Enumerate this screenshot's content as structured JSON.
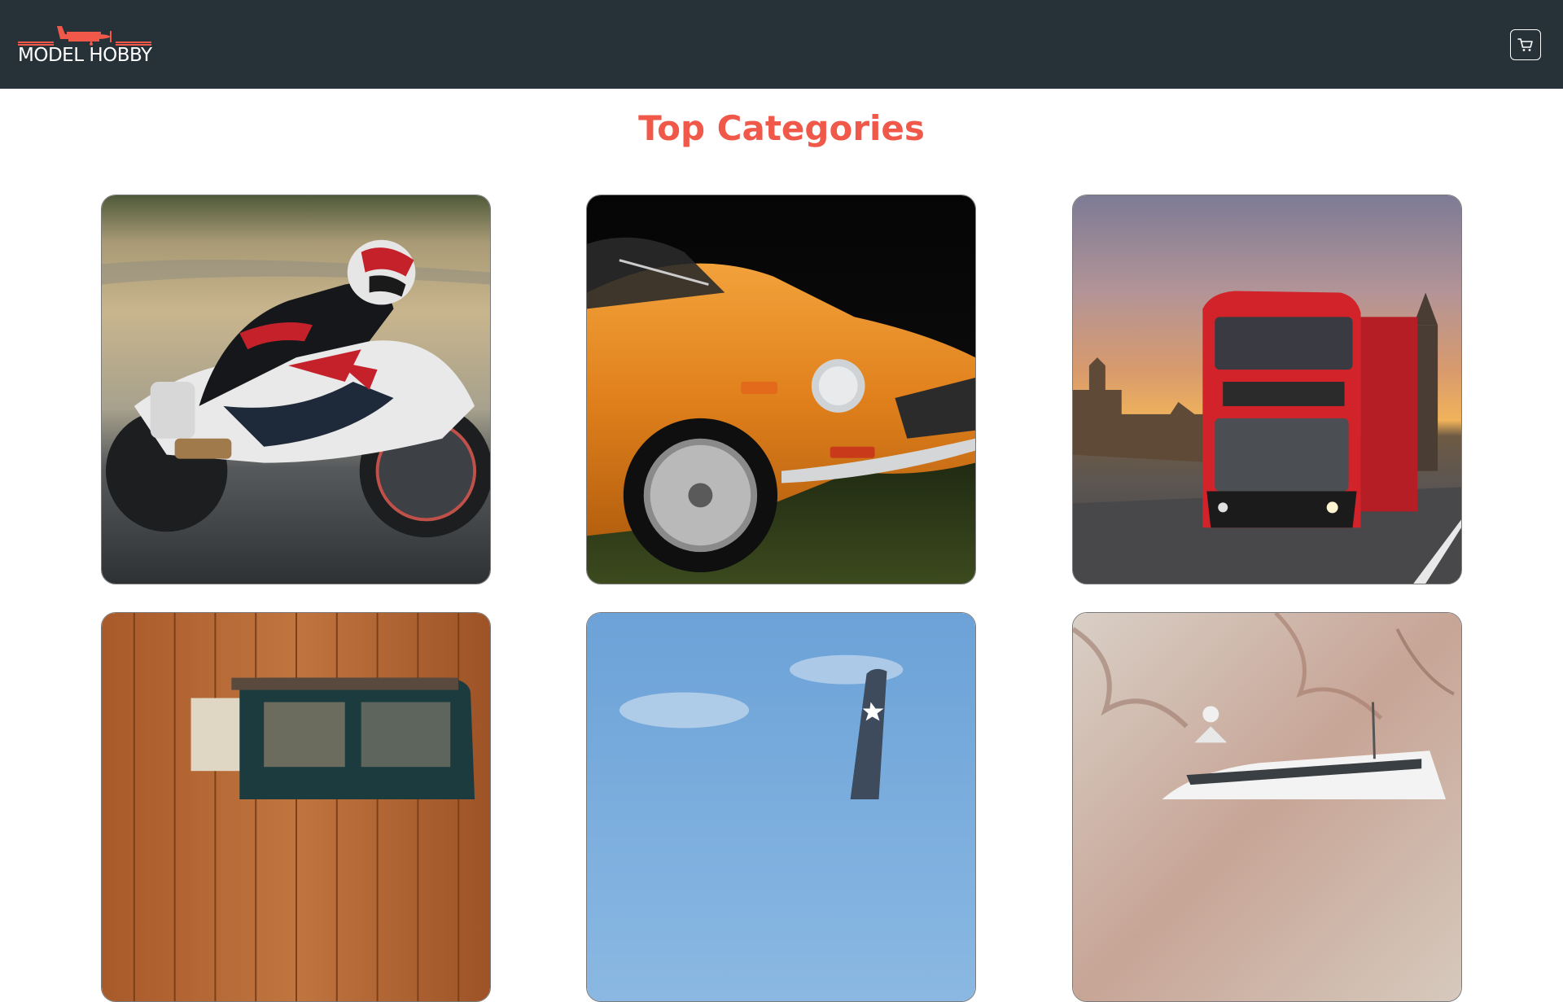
{
  "header": {
    "logo_text": "MODEL HOBBY",
    "logo_icon": "airplane-icon",
    "cart_icon": "shopping-cart-icon"
  },
  "main": {
    "title": "Top Categories"
  },
  "colors": {
    "navbar": "#263238",
    "accent": "#f0584a",
    "background": "#ffffff"
  }
}
